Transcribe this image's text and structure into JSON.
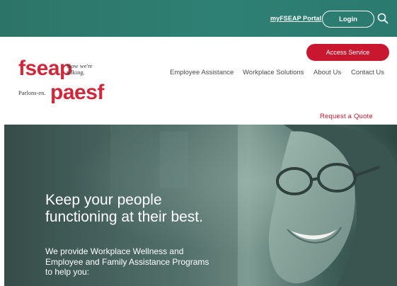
{
  "topbar": {
    "portal_link": "myFSEAP Portal",
    "login_label": "Login",
    "search_icon": "search-icon"
  },
  "header": {
    "logo": {
      "fseap": "fseap",
      "tagline_line1": "Now we're",
      "tagline_line2": "talking.",
      "parlons": "Parlons-en.",
      "paesf": "paesf"
    },
    "access_service": "Access Service",
    "nav": [
      "Employee Assistance",
      "Workplace Solutions",
      "About Us",
      "Contact Us"
    ],
    "request_quote": "Request a Quote"
  },
  "hero": {
    "heading_line1": "Keep your people",
    "heading_line2": "functioning at their best.",
    "sub_line1": "We provide Workplace Wellness and",
    "sub_line2": "Employee and Family Assistance Programs",
    "sub_line3": "to help you:"
  },
  "colors": {
    "topbar": "#2f8074",
    "brand_red": "#c8172f",
    "logo_red": "#d0283a",
    "hero_teal": "#5f7f78"
  }
}
